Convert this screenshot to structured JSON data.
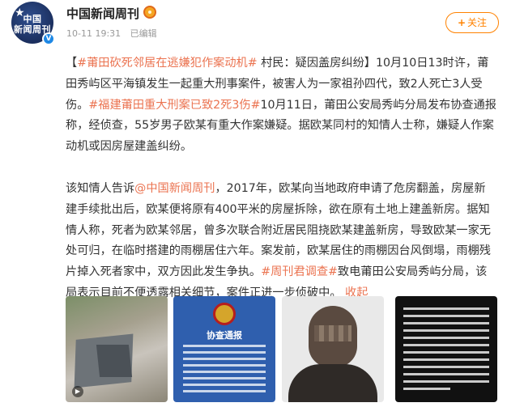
{
  "header": {
    "author_name": "中国新闻周刊",
    "avatar_text_line1": "中国",
    "avatar_text_line2": "新闻周刊",
    "verified_mark": "V",
    "timestamp": "10-11 19:31",
    "edited_label": "已编辑",
    "follow_label": "关注",
    "follow_plus": "+"
  },
  "post": {
    "paragraph1": [
      {
        "text": "【",
        "link": false
      },
      {
        "text": "#莆田砍死邻居在逃嫌犯作案动机#",
        "link": true
      },
      {
        "text": " 村民：疑因盖房纠纷】10月10日13时许，莆田秀屿区平海镇发生一起重大刑事案件，被害人为一家祖孙四代，致2人死亡3人受伤。",
        "link": false
      },
      {
        "text": "#福建莆田重大刑案已致2死3伤#",
        "link": true
      },
      {
        "text": "10月11日，莆田公安局秀屿分局发布协查通报称，经侦查，55岁男子欧某有重大作案嫌疑。据欧某同村的知情人士称，嫌疑人作案动机或因房屋建盖纠纷。",
        "link": false
      }
    ],
    "paragraph2": [
      {
        "text": "该知情人告诉",
        "link": false
      },
      {
        "text": "@中国新闻周刊",
        "link": true
      },
      {
        "text": "，2017年，欧某向当地政府申请了危房翻盖，房屋新建手续批出后，欧某便将原有400平米的房屋拆除，欲在原有土地上建盖新房。据知情人称，死者为欧某邻居，曾多次联合附近居民阻挠欧某建盖新房，导致欧某一家无处可归，在临时搭建的雨棚居住六年。案发前，欧某居住的雨棚因台风倒塌，雨棚残片掉入死者家中，双方因此发生争执。",
        "link": false
      },
      {
        "text": "#周刊君调查#",
        "link": true
      },
      {
        "text": "致电莆田公安局秀屿分局，该局表示目前不便透露相关细节，案件正进一步侦破中。",
        "link": false
      },
      {
        "text": " 收起",
        "link": true
      }
    ]
  },
  "images": {
    "notice_title": "协查通报"
  },
  "colors": {
    "link": "#eb7350",
    "follow": "#ff8200",
    "verified": "#1e88e5"
  }
}
